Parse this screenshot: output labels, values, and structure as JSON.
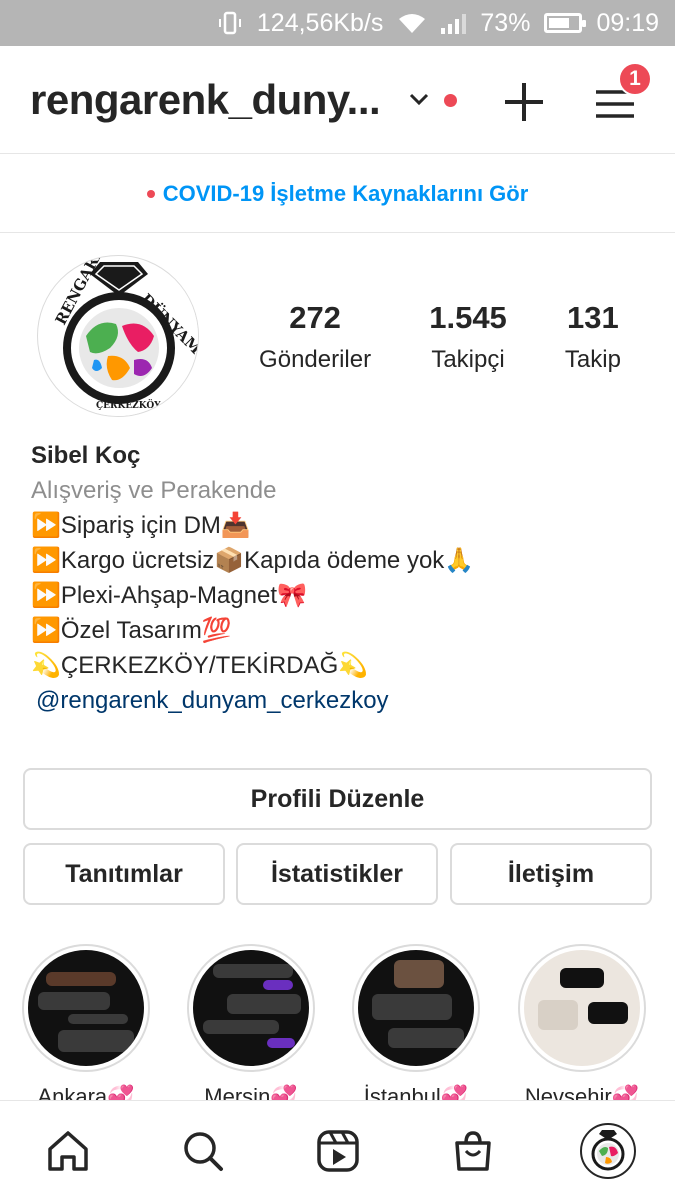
{
  "status_bar": {
    "speed": "124,56Kb/s",
    "battery_percent": "73%",
    "battery_level": 0.73,
    "time": "09:19"
  },
  "header": {
    "username": "rengarenk_duny...",
    "menu_badge": "1"
  },
  "covid_banner": {
    "text": "COVID-19 İşletme Kaynaklarını Gör"
  },
  "profile": {
    "logo_text_top": "RENGARENK DÜNYAM",
    "logo_text_bottom": "ÇERKEZKÖY",
    "stats": [
      {
        "value": "272",
        "label": "Gönderiler"
      },
      {
        "value": "1.545",
        "label": "Takipçi"
      },
      {
        "value": "131",
        "label": "Takip"
      }
    ]
  },
  "bio": {
    "name": "Sibel Koç",
    "category": "Alışveriş ve Perakende",
    "lines": [
      "⏩Sipariş için DM📥",
      "⏩Kargo ücretsiz📦Kapıda ödeme yok🙏",
      "⏩Plexi-Ahşap-Magnet🎀",
      "⏩Özel Tasarım💯",
      "💫ÇERKEZKÖY/TEKİRDAĞ💫"
    ],
    "mention": "@rengarenk_dunyam_cerkezkoy"
  },
  "buttons": {
    "edit_profile": "Profili Düzenle",
    "promotions": "Tanıtımlar",
    "insights": "İstatistikler",
    "contact": "İletişim"
  },
  "highlights": [
    {
      "label": "Ankara💞"
    },
    {
      "label": "Mersin💞"
    },
    {
      "label": "İstanbul💞"
    },
    {
      "label": "Nevşehir💞"
    }
  ],
  "bottom_nav": {
    "items": [
      "home-icon",
      "search-icon",
      "reels-icon",
      "shop-icon",
      "profile-avatar"
    ]
  },
  "colors": {
    "accent_blue": "#0095f6",
    "badge_red": "#ed4956",
    "mention_blue": "#00376b",
    "muted": "#8e8e8e"
  }
}
